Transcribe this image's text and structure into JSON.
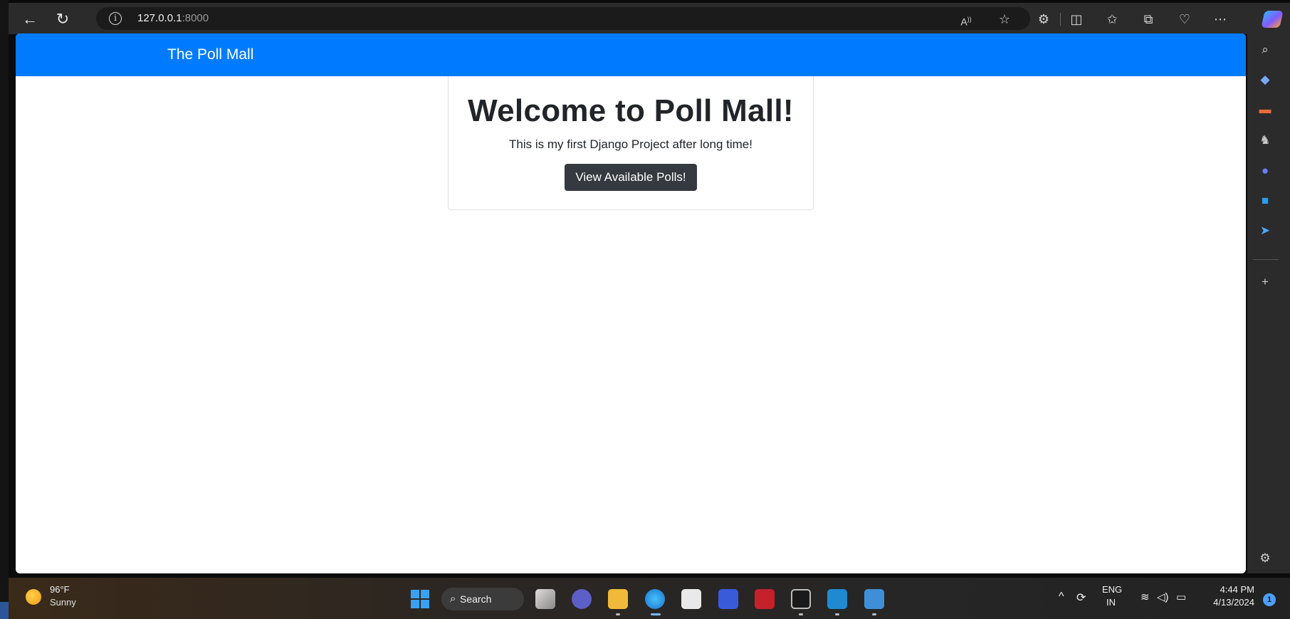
{
  "browser": {
    "url_host": "127.0.0.1",
    "url_port": ":8000"
  },
  "page": {
    "brand": "The Poll Mall",
    "heading": "Welcome to Poll Mall!",
    "subtitle": "This is my first Django Project after long time!",
    "button_label": "View Available Polls!"
  },
  "taskbar": {
    "weather_temp": "96°F",
    "weather_condition": "Sunny",
    "search_label": "Search",
    "language_top": "ENG",
    "language_bottom": "IN",
    "time": "4:44 PM",
    "date": "4/13/2024",
    "notification_count": "1"
  },
  "colors": {
    "navbar": "#007bff",
    "button": "#343a40"
  }
}
